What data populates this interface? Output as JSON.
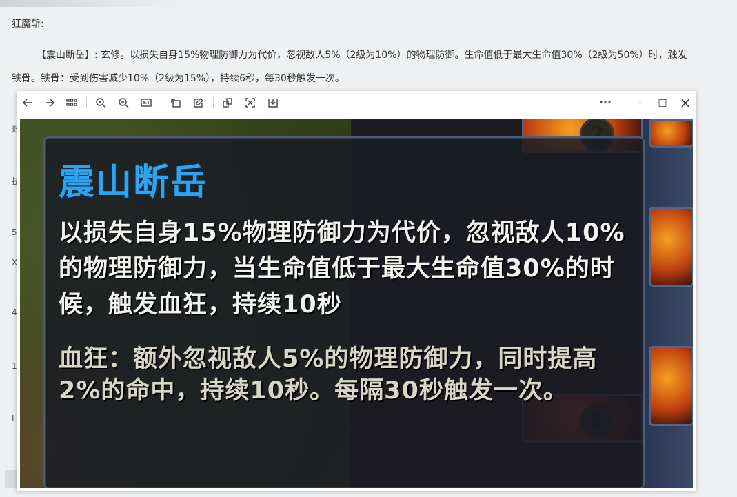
{
  "article": {
    "title": "狂魔斩:",
    "paragraph": "【震山断岳】: 玄修。以损失自身15%物理防御力为代价，忽视敌人5%（2级为10%）的物理防御。生命值低于最大生命值30%（2级为50%）时，触发铁骨。铁骨：受到伤害减少10%（2级为15%），持续6秒，每30秒触发一次。",
    "left_chars": [
      "效",
      "技",
      "5",
      "X",
      "4",
      "1",
      "I"
    ]
  },
  "viewer": {
    "toolbar": {
      "back": "back-arrow-icon",
      "forward": "forward-arrow-icon",
      "grid": "grid-icon",
      "zoom_in": "zoom-in-icon",
      "zoom_out": "zoom-out-icon",
      "actual_size": "actual-size-icon",
      "rotate": "rotate-icon",
      "edit": "edit-icon",
      "copy": "copy-icon",
      "ocr": "scan-icon",
      "download": "download-icon",
      "more": "···",
      "minimize": "–",
      "maximize": "□",
      "close": "×"
    },
    "game_tooltip": {
      "skill_name": "震山断岳",
      "description": "以损失自身15%物理防御力为代价，忽视敌人10%的物理防御力，当生命值低于最大生命值30%的时候，触发血狂，持续10秒",
      "sub_effect": "血狂：额外忽视敌人5%的物理防御力，同时提高2%的命中，持续10秒。每隔30秒触发一次。"
    },
    "slot_badges": [
      "2",
      "2"
    ]
  },
  "colors": {
    "skill_name": "#2ea3f0",
    "description": "#f2f2ee",
    "sub_effect": "#d9d6c8"
  }
}
